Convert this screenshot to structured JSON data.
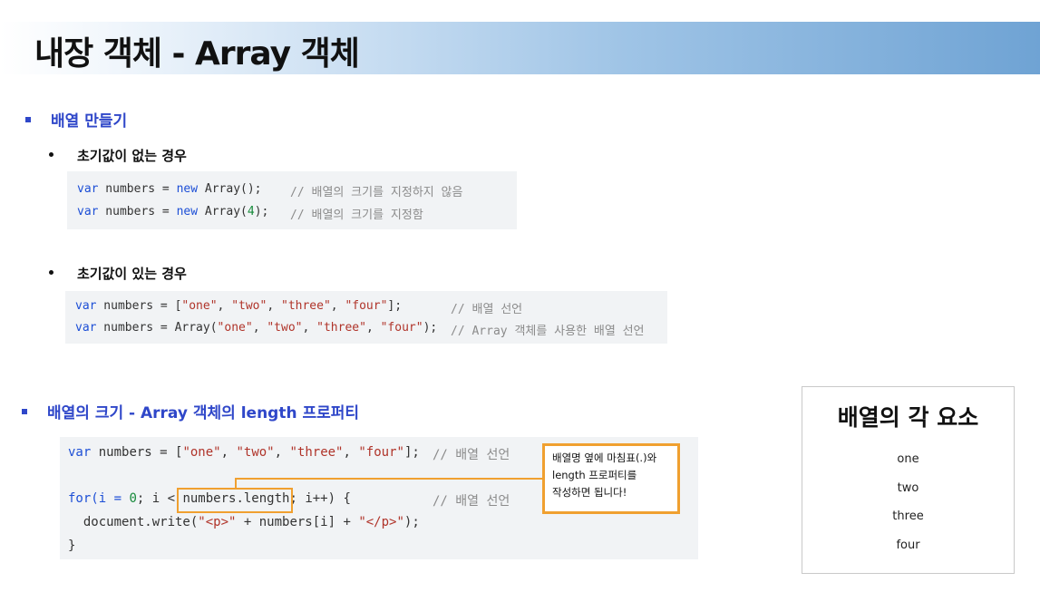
{
  "title": "내장 객체 - Array 객체",
  "section1": {
    "heading": "배열 만들기",
    "bullet1": {
      "label": "초기값이 없는 경우",
      "code": [
        {
          "kw1": "var",
          "a": " numbers = ",
          "kw2": "new",
          "b": " Array();",
          "num": "",
          "c": "",
          "comment": "// 배열의 크기를 지정하지 않음"
        },
        {
          "kw1": "var",
          "a": " numbers = ",
          "kw2": "new",
          "b": " Array(",
          "num": "4",
          "c": ");",
          "comment": "// 배열의 크기를 지정함"
        }
      ]
    },
    "bullet2": {
      "label": "초기값이 있는 경우",
      "code": [
        {
          "a": " numbers = [",
          "s1": "\"one\"",
          "s2": "\"two\"",
          "s3": "\"three\"",
          "s4": "\"four\"",
          "b": "];",
          "comment": "// 배열 선언"
        },
        {
          "a": " numbers = Array(",
          "s1": "\"one\"",
          "s2": "\"two\"",
          "s3": "\"three\"",
          "s4": "\"four\"",
          "b": ");",
          "comment": "// Array 객체를 사용한 배열 선언"
        }
      ]
    }
  },
  "section2": {
    "heading": "배열의 크기 - Array 객체의 length 프로퍼티",
    "code": {
      "l1": {
        "a": " numbers = [",
        "s1": "\"one\"",
        "s2": "\"two\"",
        "s3": "\"three\"",
        "s4": "\"four\"",
        "b": "];",
        "comment": "// 배열 선언"
      },
      "l2": {
        "a": "for(i = ",
        "num": "0",
        "b": "; i < ",
        "hl": "numbers.length",
        "c": "; i++) {",
        "comment": "// 배열 선언"
      },
      "l3": {
        "a": "  document.write(",
        "s1": "\"<p>\"",
        "b": " + numbers[i] + ",
        "s2": "\"</p>\"",
        "c": ");"
      },
      "l4": "}"
    },
    "callout": {
      "line1": "배열명 옆에 마침표(.)와",
      "line2": "length 프로퍼티를",
      "line3": "작성하면 됩니다!"
    }
  },
  "result": {
    "title": "배열의 각 요소",
    "items": [
      "one",
      "two",
      "three",
      "four"
    ]
  },
  "keyword": "var",
  "colors": {
    "accent": "#2f47c9",
    "highlight": "#f0a030",
    "keyword": "#1d4fd6",
    "string": "#b0342a",
    "number": "#168a3a",
    "comment": "#8b8b8b"
  }
}
